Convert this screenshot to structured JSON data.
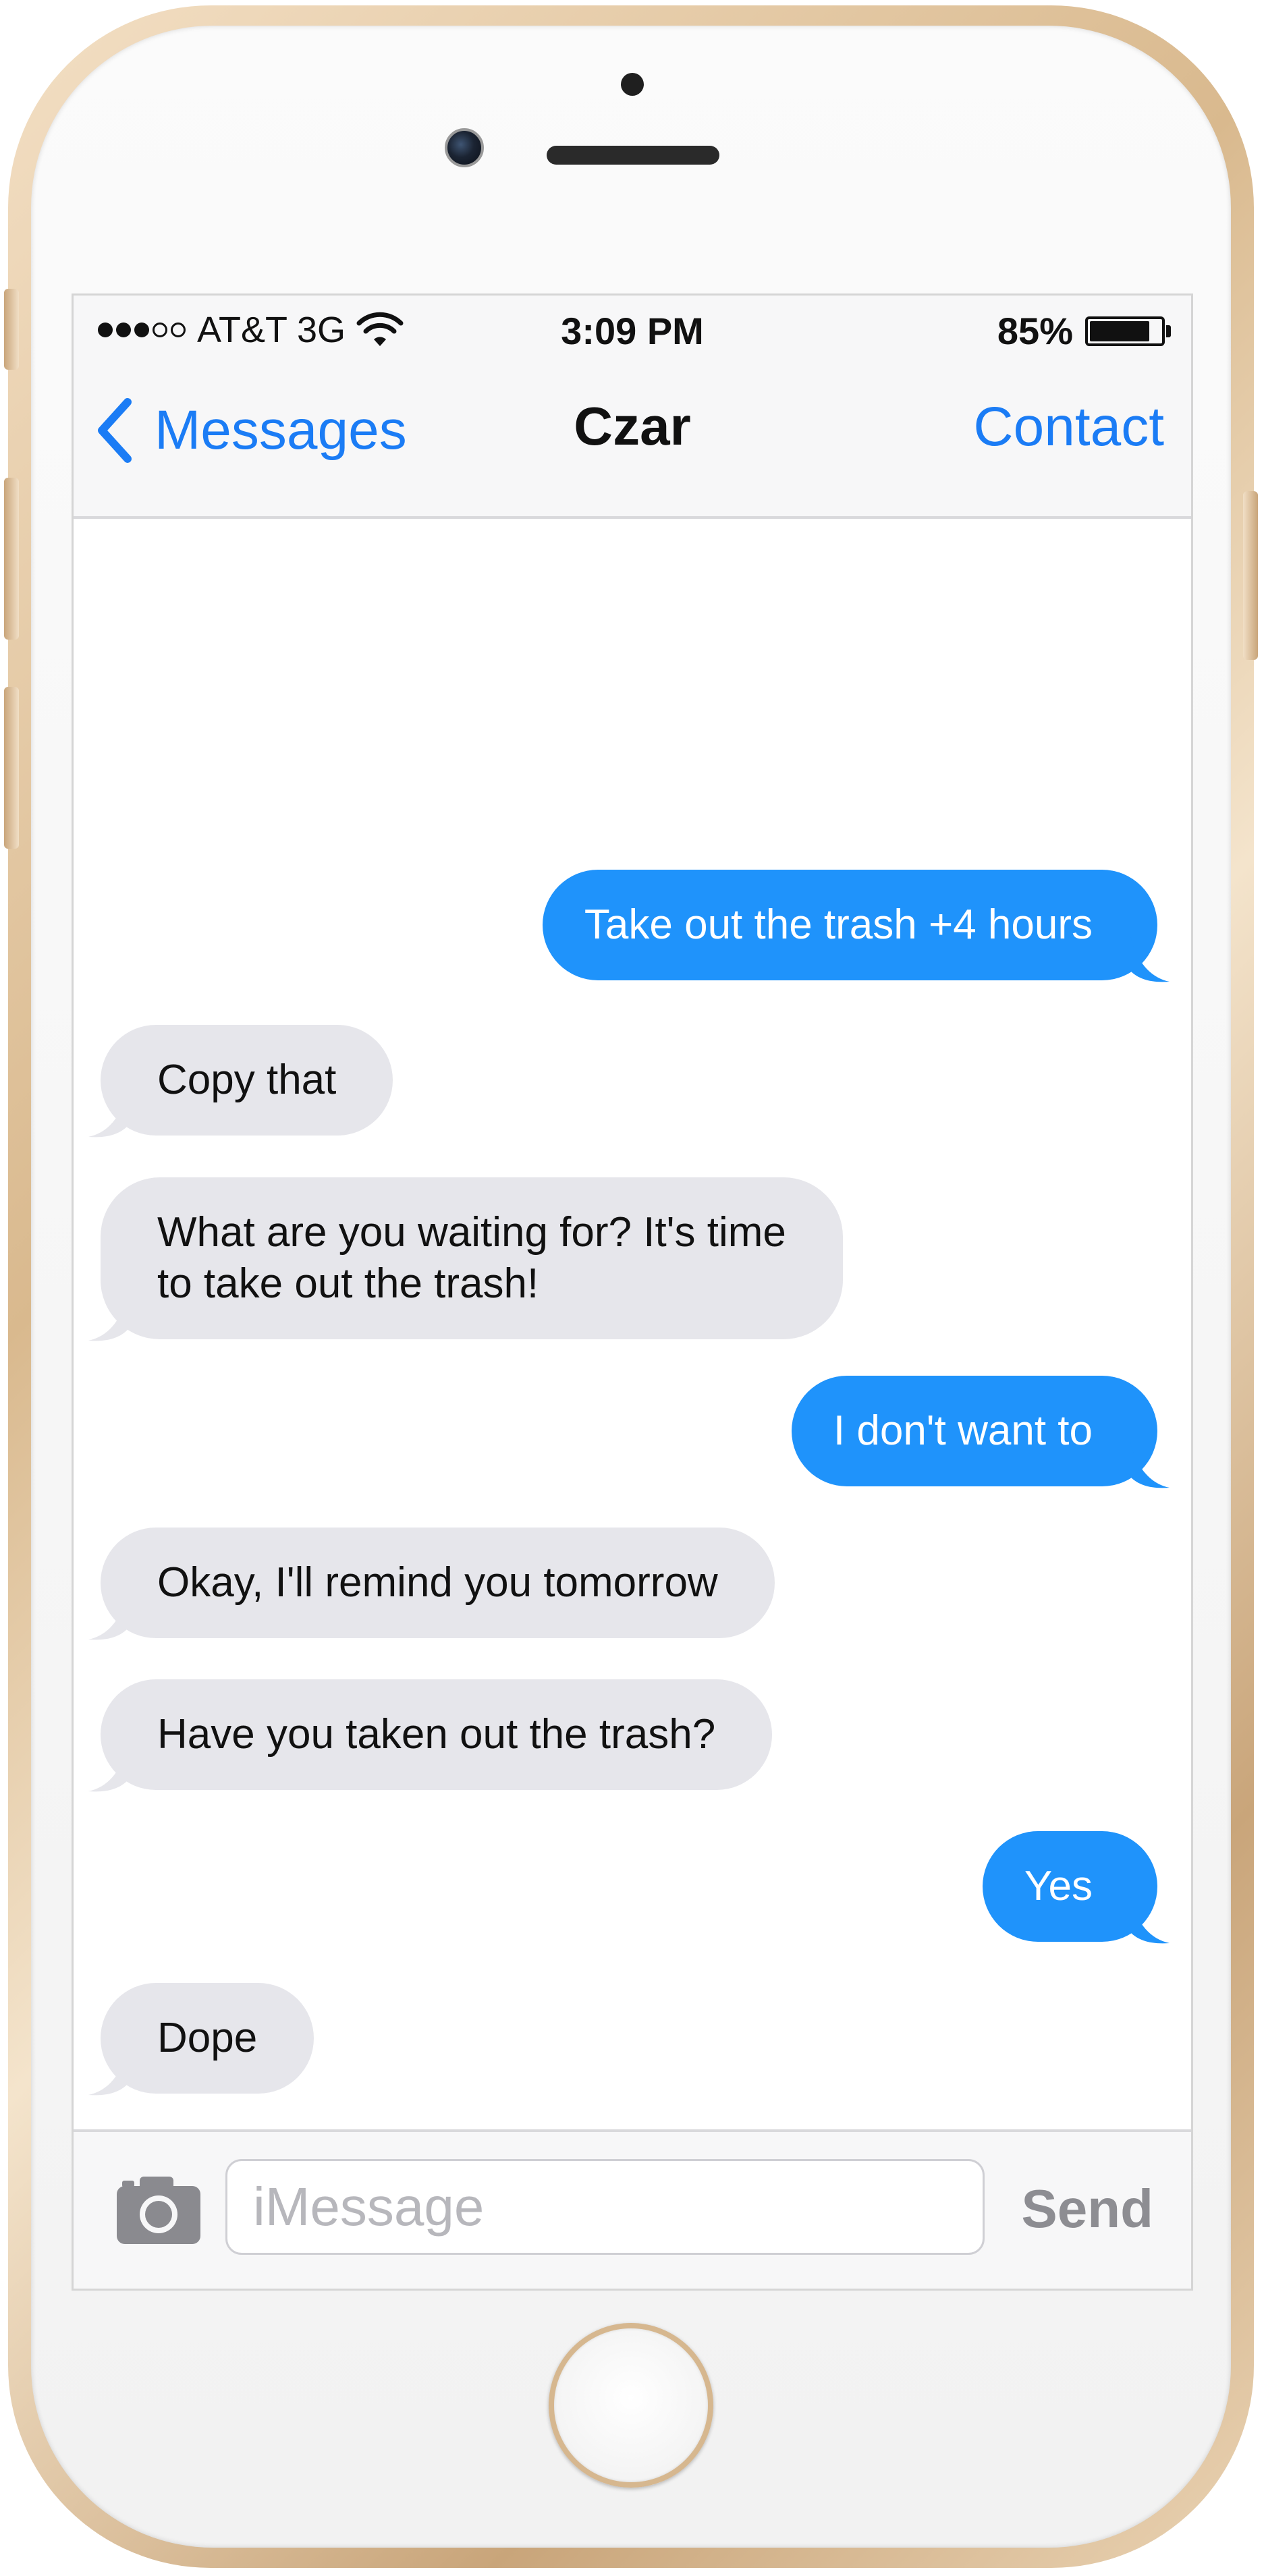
{
  "status_bar": {
    "carrier": "AT&T 3G",
    "time": "3:09 PM",
    "battery_percent": "85%",
    "battery_level": 0.85,
    "signal_bars_filled": 3,
    "signal_bars_total": 5
  },
  "nav": {
    "back_label": "Messages",
    "title": "Czar",
    "contact_label": "Contact"
  },
  "messages": [
    {
      "direction": "outgoing",
      "text": "Take out the trash +4 hours"
    },
    {
      "direction": "incoming",
      "text": "Copy that"
    },
    {
      "direction": "incoming",
      "text": "What are you waiting for? It's time\nto take out the trash!"
    },
    {
      "direction": "outgoing",
      "text": "I don't want to"
    },
    {
      "direction": "incoming",
      "text": "Okay, I'll remind you tomorrow"
    },
    {
      "direction": "incoming",
      "text": "Have you taken out the trash?"
    },
    {
      "direction": "outgoing",
      "text": "Yes"
    },
    {
      "direction": "incoming",
      "text": "Dope"
    }
  ],
  "input_bar": {
    "placeholder": "iMessage",
    "value": "",
    "send_label": "Send"
  },
  "colors": {
    "accent": "#1b7cf5",
    "outgoing_bubble": "#1f93fb",
    "incoming_bubble": "#e6e6eb"
  },
  "icons": {
    "back": "chevron-left-icon",
    "camera": "camera-icon",
    "wifi": "wifi-icon",
    "battery": "battery-icon"
  }
}
